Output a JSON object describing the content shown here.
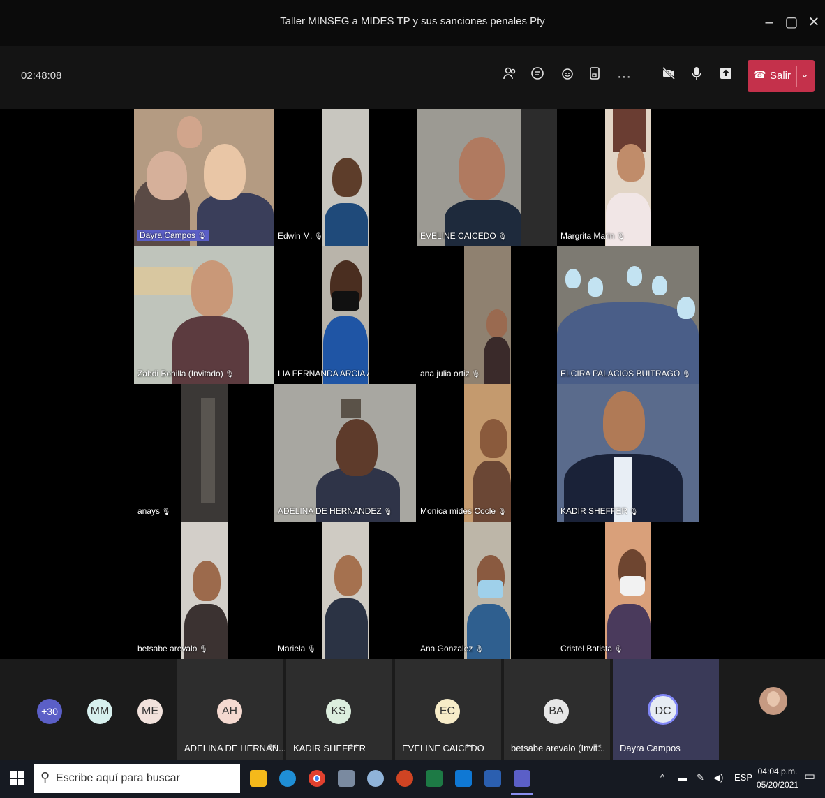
{
  "window": {
    "title": "Taller MINSEG a MIDES TP y sus sanciones penales Pty"
  },
  "toolbar": {
    "timer": "02:48:08",
    "leave_label": "Salir"
  },
  "tiles": [
    {
      "name": "Dayra Campos",
      "highlight": true
    },
    {
      "name": "Edwin M."
    },
    {
      "name": "EVELINE CAICEDO"
    },
    {
      "name": "Margrita Marin"
    },
    {
      "name": "Zabdi Bonilla (Invitado)"
    },
    {
      "name": "LIA FERNANDA ARCIA ARAUZ"
    },
    {
      "name": "ana julia ortiz"
    },
    {
      "name": "ELCIRA PALACIOS BUITRAGO"
    },
    {
      "name": "anays"
    },
    {
      "name": "ADELINA DE HERNANDEZ"
    },
    {
      "name": "Monica mides Cocle"
    },
    {
      "name": "KADIR SHEFFER"
    },
    {
      "name": "betsabe arevalo"
    },
    {
      "name": "Mariela"
    },
    {
      "name": "Ana Gonzalez"
    },
    {
      "name": "Cristel Batista"
    }
  ],
  "strip": {
    "more": "+30",
    "avatars": [
      {
        "initials": "MM",
        "color": "#d7f0ee"
      },
      {
        "initials": "ME",
        "color": "#f2e2dc"
      }
    ],
    "tiles": [
      {
        "initials": "AH",
        "name": "ADELINA DE HERNAN...",
        "color": "#f5d9d0"
      },
      {
        "initials": "KS",
        "name": "KADIR SHEFFER",
        "color": "#dceede"
      },
      {
        "initials": "EC",
        "name": "EVELINE CAICEDO",
        "color": "#f7ecc8"
      },
      {
        "initials": "BA",
        "name": "betsabe arevalo (Invit...",
        "color": "#e6e6e6"
      },
      {
        "initials": "DC",
        "name": "Dayra Campos",
        "color": "#e6ecf3"
      }
    ]
  },
  "taskbar": {
    "search_placeholder": "Escribe aquí para buscar",
    "lang": "ESP",
    "time": "04:04 p.m.",
    "date": "05/20/2021"
  },
  "colors": {
    "leave": "#c4314b",
    "speaker_highlight": "#5b5fc7",
    "more_avatar": "#5b5fc7"
  }
}
